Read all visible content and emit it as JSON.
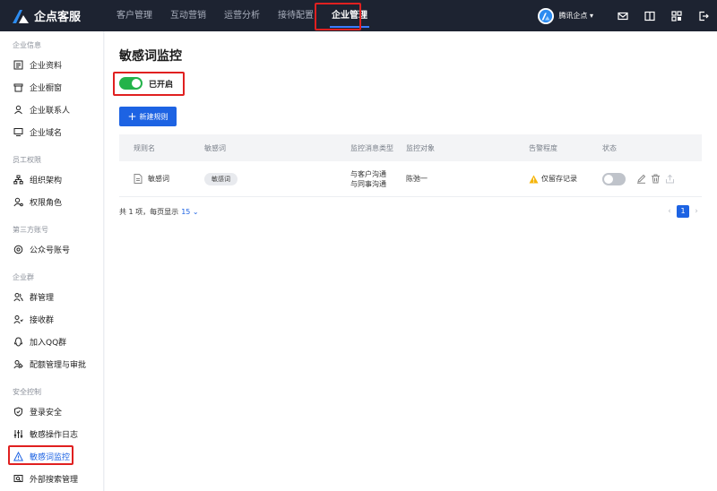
{
  "brand": {
    "name": "企点客服"
  },
  "nav": {
    "items": [
      {
        "label": "客户管理"
      },
      {
        "label": "互动营销"
      },
      {
        "label": "运营分析"
      },
      {
        "label": "接待配置"
      },
      {
        "label": "企业管理"
      }
    ],
    "active_index": 4
  },
  "user": {
    "name": "腾讯企点"
  },
  "top_icons": [
    "mail-icon",
    "book-icon",
    "grid-icon",
    "logout-icon"
  ],
  "sidebar": {
    "groups": [
      {
        "title": "企业信息",
        "items": [
          {
            "label": "企业资料",
            "icon": "document-list-icon"
          },
          {
            "label": "企业橱窗",
            "icon": "storefront-icon"
          },
          {
            "label": "企业联系人",
            "icon": "person-icon"
          },
          {
            "label": "企业域名",
            "icon": "monitor-icon"
          }
        ]
      },
      {
        "title": "员工权限",
        "items": [
          {
            "label": "组织架构",
            "icon": "org-chart-icon"
          },
          {
            "label": "权限角色",
            "icon": "role-icon"
          }
        ]
      },
      {
        "title": "第三方账号",
        "items": [
          {
            "label": "公众号账号",
            "icon": "settings-circle-icon"
          }
        ]
      },
      {
        "title": "企业群",
        "items": [
          {
            "label": "群管理",
            "icon": "group-icon"
          },
          {
            "label": "接收群",
            "icon": "group-receive-icon"
          },
          {
            "label": "加入QQ群",
            "icon": "qq-icon"
          },
          {
            "label": "配额管理与审批",
            "icon": "quota-icon"
          }
        ]
      },
      {
        "title": "安全控制",
        "items": [
          {
            "label": "登录安全",
            "icon": "shield-icon"
          },
          {
            "label": "敏感操作日志",
            "icon": "sliders-icon"
          },
          {
            "label": "敏感词监控",
            "icon": "warning-triangle-icon"
          },
          {
            "label": "外部搜索管理",
            "icon": "search-box-icon"
          }
        ]
      }
    ],
    "active_label": "敏感词监控"
  },
  "main": {
    "title": "敏感词监控",
    "toggle": {
      "state": "on",
      "label": "已开启"
    },
    "new_rule_button": {
      "label": "新建规则"
    },
    "table": {
      "columns": [
        "规则名",
        "敏感词",
        "监控消息类型",
        "监控对象",
        "告警程度",
        "状态"
      ],
      "rows": [
        {
          "name": "敏感词",
          "tag": "敏感词",
          "message_type_1": "与客户沟通",
          "message_type_2": "与同事沟通",
          "target": "陈弛一",
          "alert_level": "仅留存记录",
          "status": "off"
        }
      ]
    },
    "footer": {
      "total": "共 1 项，每页显示",
      "page_size": "15",
      "current_page": "1"
    }
  },
  "colors": {
    "topbar": "#1d2331",
    "accent": "#1d63e3",
    "toggle_on": "#23b34a",
    "highlight": "#e02020"
  }
}
